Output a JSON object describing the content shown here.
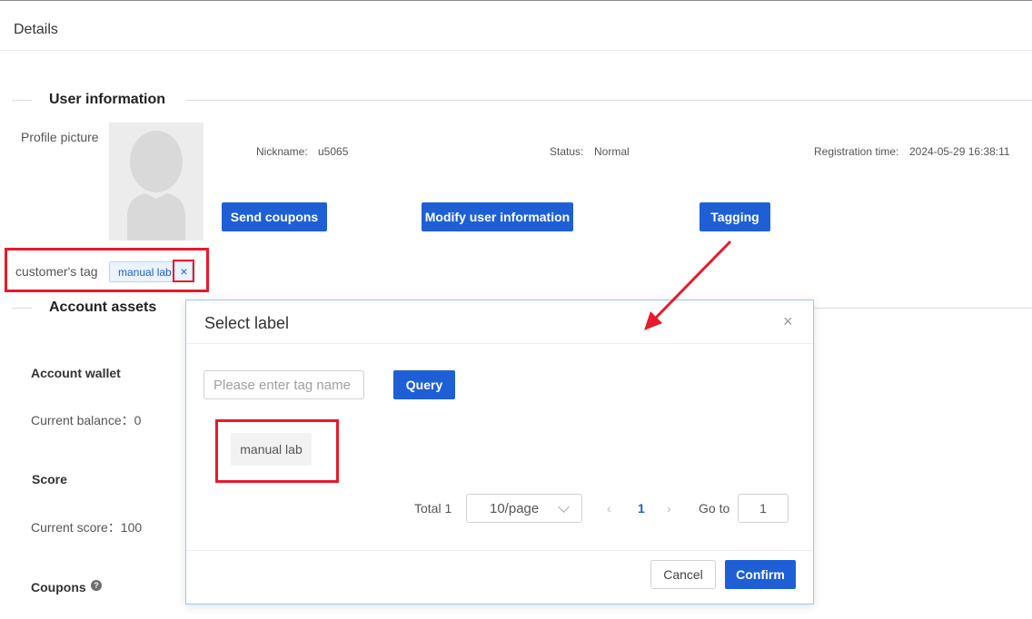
{
  "page": {
    "title": "Details"
  },
  "user_info": {
    "section_title": "User information",
    "profile_label": "Profile picture",
    "nickname_label": "Nickname:",
    "nickname_value": "u5065",
    "status_label": "Status:",
    "status_value": "Normal",
    "registration_label": "Registration time:",
    "registration_value": "2024-05-29 16:38:11",
    "buttons": {
      "send_coupons": "Send coupons",
      "modify_user": "Modify user information",
      "tagging": "Tagging"
    },
    "customer_tag_label": "customer's tag",
    "customer_tag_value": "manual lab",
    "tag_close_glyph": "×"
  },
  "account_assets": {
    "section_title": "Account assets",
    "wallet_title": "Account wallet",
    "balance_text": "Current balance：0",
    "score_title": "Score",
    "score_text": "Current score：100",
    "coupons_title": "Coupons",
    "coupons_help_glyph": "?"
  },
  "modal": {
    "title": "Select label",
    "close_glyph": "×",
    "search_placeholder": "Please enter tag name",
    "search_value": "",
    "query_label": "Query",
    "tags": [
      "manual lab"
    ],
    "pagination": {
      "total_text": "Total 1",
      "page_size": "10/page",
      "prev_glyph": "‹",
      "next_glyph": "›",
      "current_page": "1",
      "goto_label": "Go to",
      "goto_value": "1"
    },
    "cancel_label": "Cancel",
    "confirm_label": "Confirm"
  },
  "colors": {
    "primary": "#1e5fd6",
    "annotation_red": "#e8192c"
  },
  "icons": {
    "avatar": "default-user-silhouette",
    "help": "question-circle-icon",
    "close": "close-icon",
    "dropdown": "chevron-down-icon"
  }
}
